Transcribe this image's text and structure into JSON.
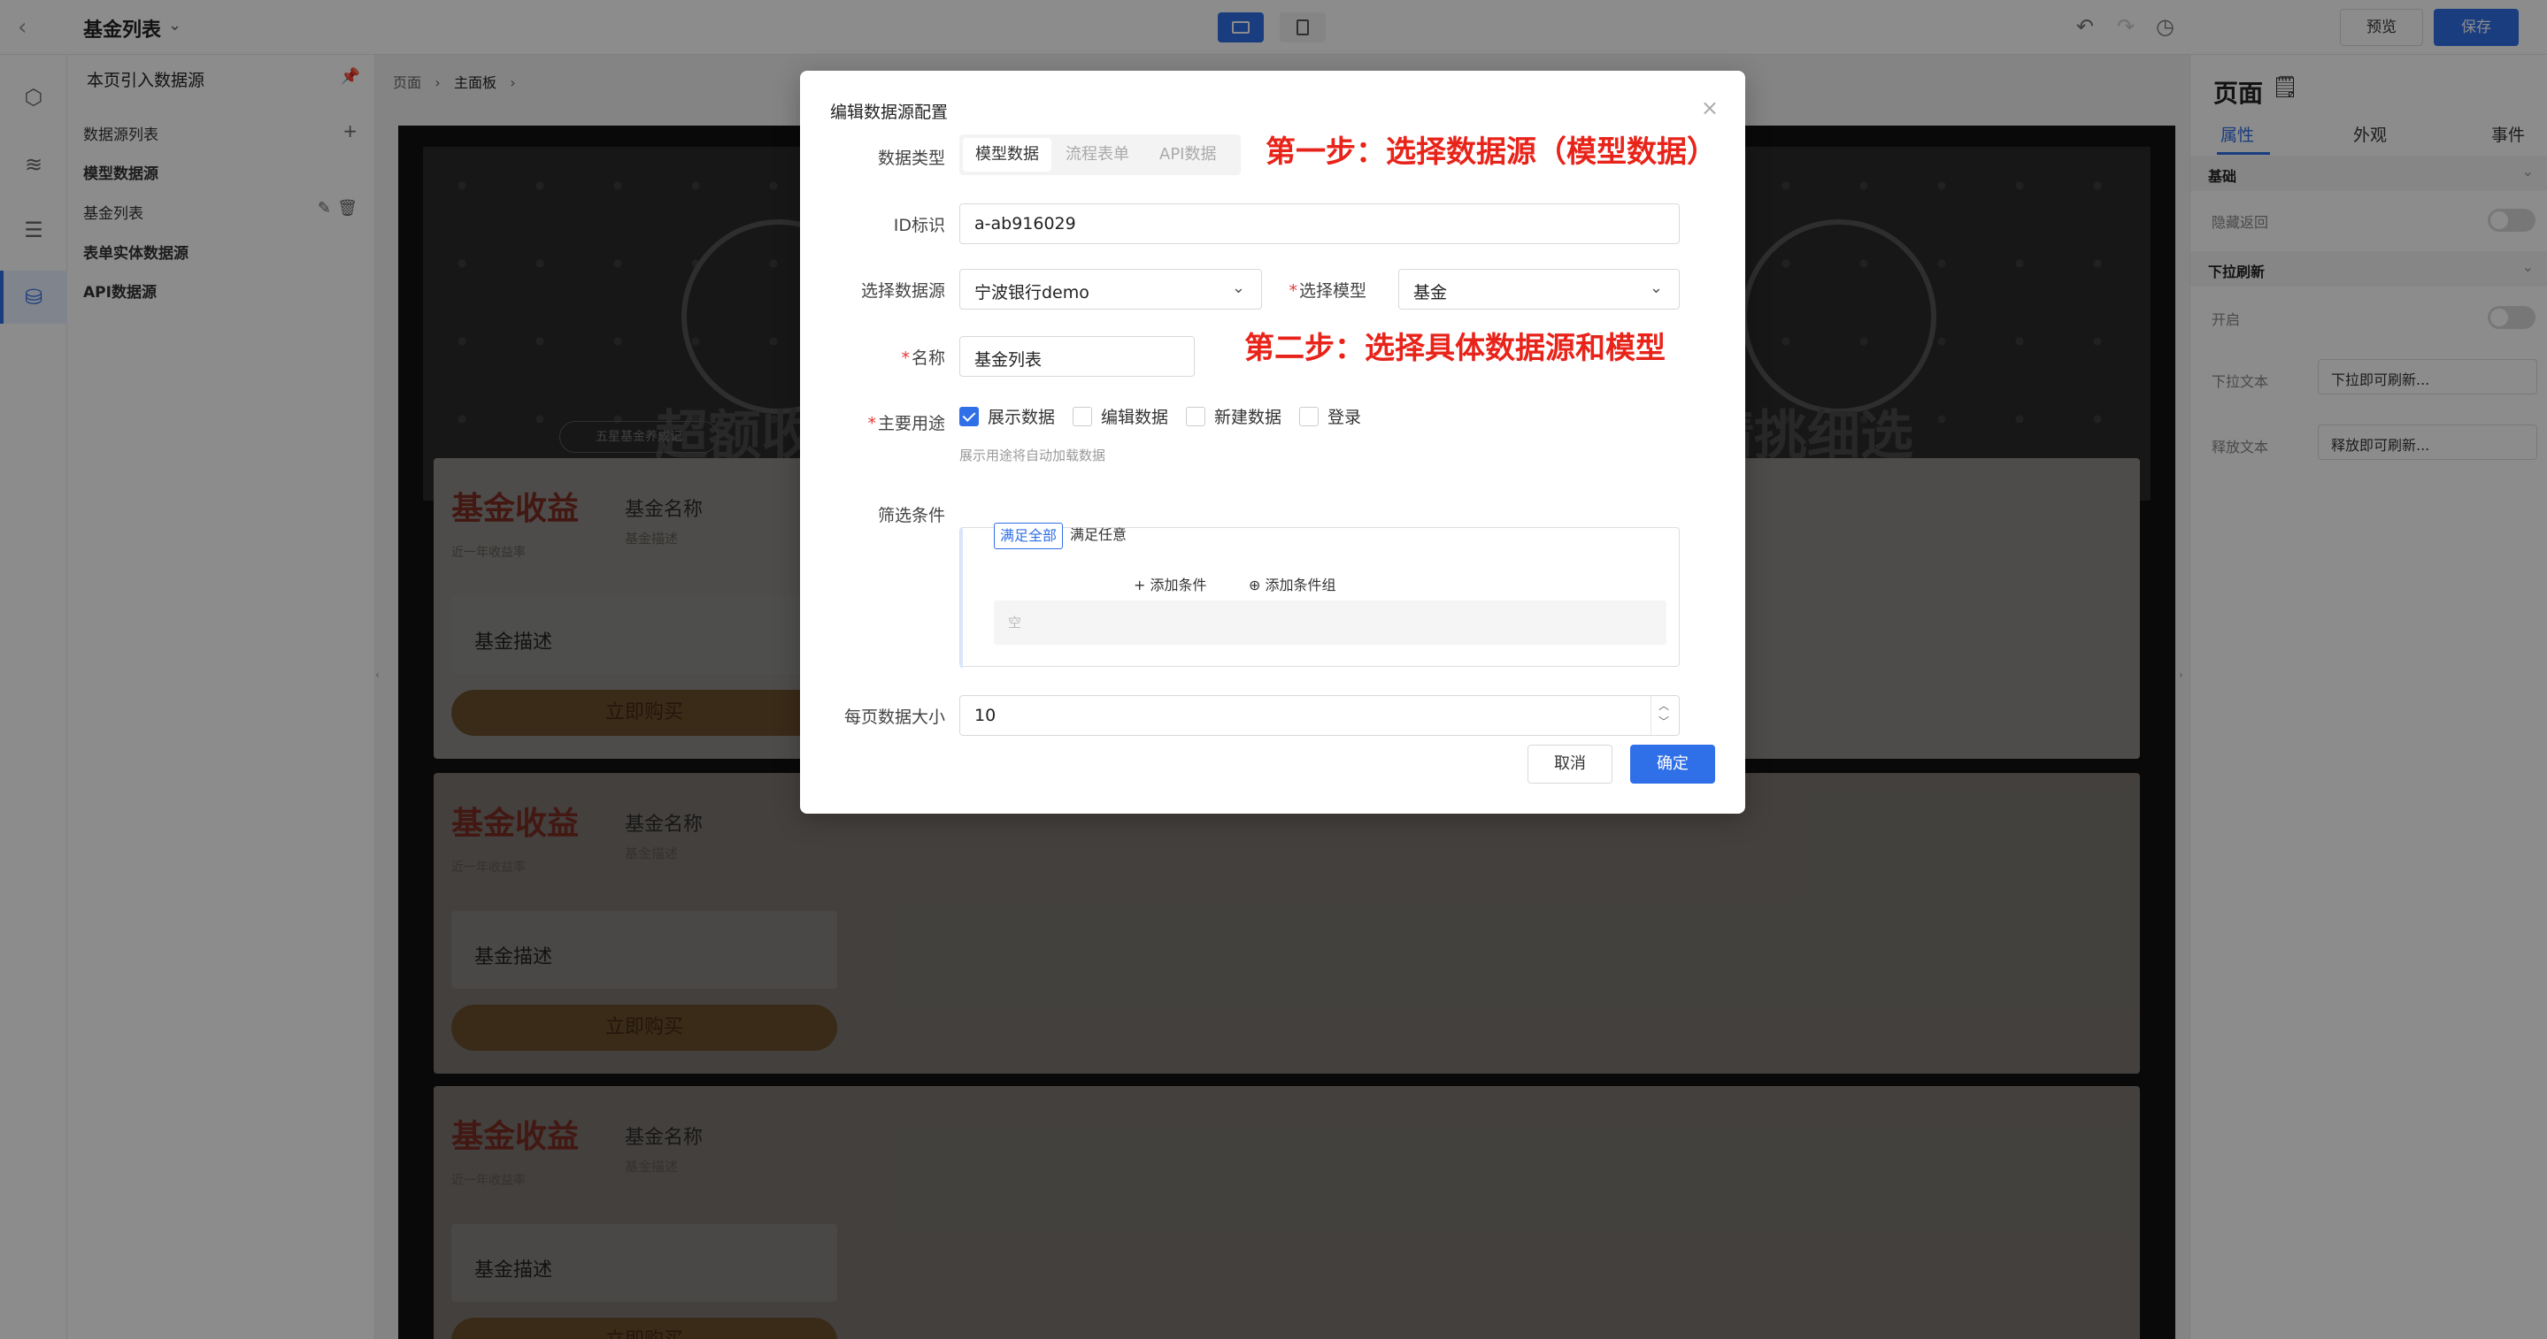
{
  "topbar": {
    "back_icon": "chevron-left-icon",
    "title": "基金列表",
    "title_caret": "⌄",
    "preview_label": "预览",
    "save_label": "保存",
    "undo_icon": "↶",
    "redo_icon": "↷",
    "history_icon": "◷",
    "accent_color": "#2f6fe8"
  },
  "rail": {
    "icons": [
      "cube-icon",
      "layers-icon",
      "sliders-icon",
      "database-icon"
    ]
  },
  "datasource_panel": {
    "header": "本页引入数据源",
    "pin_icon": "pin-icon",
    "list_title": "数据源列表",
    "add_icon": "+",
    "model_group": "模型数据源",
    "model_item": "基金列表",
    "form_group": "表单实体数据源",
    "api_group": "API数据源"
  },
  "canvas": {
    "breadcrumb_page": "页面",
    "breadcrumb_current": "主面板",
    "hero_text_left": "超额收",
    "hero_text_right": "精挑细选",
    "hero_tag": "五星基金养成记",
    "cards": [
      {
        "title": "基金收益",
        "subtitle": "近一年收益率",
        "name": "基金名称",
        "name_sub": "基金描述",
        "desc": "基金描述",
        "buy": "立即购买"
      },
      {
        "title": "基金收益",
        "subtitle": "近一年收益率",
        "name": "基金名称",
        "name_sub": "基金描述",
        "desc": "基金描述",
        "buy": "立即购买"
      },
      {
        "title": "基金收益",
        "subtitle": "近一年收益率",
        "name": "基金名称",
        "name_sub": "基金描述",
        "desc": "基金描述",
        "buy": "立即购买"
      }
    ]
  },
  "right_panel": {
    "title": "页面",
    "tabs": [
      "属性",
      "外观",
      "事件"
    ],
    "section_basic": "基础",
    "hide_back_label": "隐藏返回",
    "section_pull": "下拉刷新",
    "enable_label": "开启",
    "pull_text_label": "下拉文本",
    "pull_text_value": "下拉即可刷新...",
    "release_text_label": "释放文本",
    "release_text_value": "释放即可刷新..."
  },
  "modal": {
    "title": "编辑数据源配置",
    "close_icon": "×",
    "type_label": "数据类型",
    "type_options": [
      "模型数据",
      "流程表单",
      "API数据"
    ],
    "id_label": "ID标识",
    "id_value": "a-ab916029",
    "source_label": "选择数据源",
    "source_value": "宁波银行demo",
    "model_label": "选择模型",
    "model_value": "基金",
    "name_label": "名称",
    "name_value": "基金列表",
    "usage_label": "主要用途",
    "usage_options": [
      {
        "label": "展示数据",
        "checked": true
      },
      {
        "label": "编辑数据",
        "checked": false
      },
      {
        "label": "新建数据",
        "checked": false
      },
      {
        "label": "登录",
        "checked": false
      }
    ],
    "usage_hint": "展示用途将自动加载数据",
    "filter_label": "筛选条件",
    "filter_all": "满足全部",
    "filter_any": "满足任意",
    "add_condition": "+ 添加条件",
    "add_group": "⊕ 添加条件组",
    "empty_text": "空",
    "pagesize_label": "每页数据大小",
    "pagesize_value": "10",
    "cancel_label": "取消",
    "ok_label": "确定",
    "annotation_step1": "第一步：选择数据源（模型数据）",
    "annotation_step2": "第二步：选择具体数据源和模型",
    "annotation_color": "#e8231a"
  }
}
